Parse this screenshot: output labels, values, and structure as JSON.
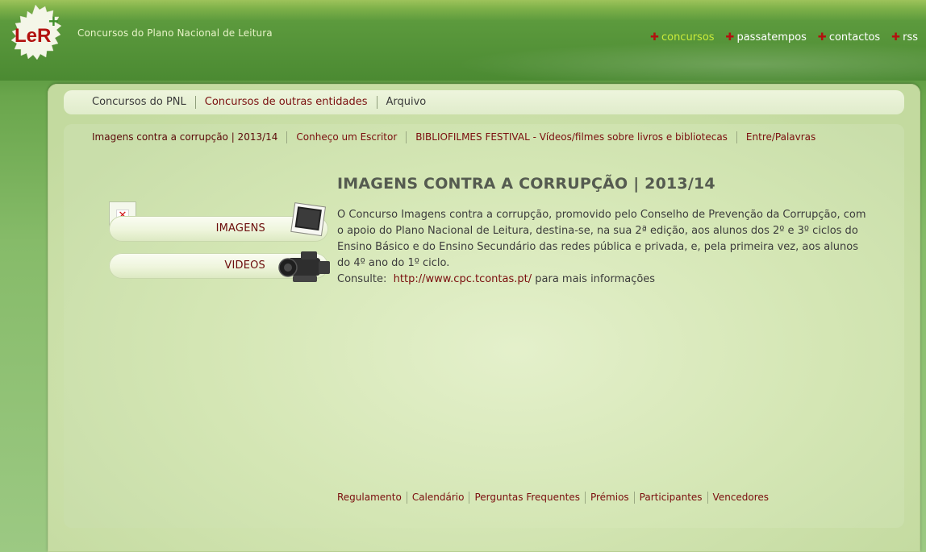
{
  "header": {
    "logo_text": "LeR",
    "logo_plus": "+",
    "tagline": "Concursos do Plano Nacional de Leitura",
    "nav": [
      {
        "label": "concursos",
        "active": true
      },
      {
        "label": "passatempos",
        "active": false
      },
      {
        "label": "contactos",
        "active": false
      },
      {
        "label": "rss",
        "active": false
      }
    ],
    "nav_marker": "✚"
  },
  "tabs": [
    {
      "label": "Concursos do PNL",
      "active": false
    },
    {
      "label": "Concursos de outras entidades",
      "active": true
    },
    {
      "label": "Arquivo",
      "active": false
    }
  ],
  "subnav": [
    {
      "label": "Imagens contra a corrupção | 2013/14",
      "active": true
    },
    {
      "label": "Conheço um Escritor",
      "active": false
    },
    {
      "label": "BIBLIOFILMES FESTIVAL - Vídeos/filmes sobre livros e bibliotecas",
      "active": false
    },
    {
      "label": "Entre/Palavras",
      "active": false
    }
  ],
  "sidebar": {
    "broken_image_icon": "broken-image-icon",
    "buttons": [
      {
        "label": "IMAGENS",
        "icon": "photo-icon"
      },
      {
        "label": "VIDEOS",
        "icon": "video-camera-icon"
      }
    ]
  },
  "content": {
    "title": "IMAGENS CONTRA A CORRUPÇÃO | 2013/14",
    "paragraph": "O Concurso Imagens contra a corrupção, promovido pelo Conselho de Prevenção da Corrupção, com o apoio do Plano Nacional de Leitura, destina-se, na sua 2ª edição, aos alunos dos 2º e 3º ciclos do Ensino Básico e do Ensino Secundário das redes pública e privada, e, pela primeira vez,  aos alunos do 4º ano do 1º ciclo.",
    "consult_prefix": "Consulte:",
    "link": "http://www.cpc.tcontas.pt/",
    "consult_suffix": "para mais informações"
  },
  "footer_links": [
    "Regulamento",
    "Calendário",
    "Perguntas Frequentes",
    "Prémios",
    "Participantes",
    "Vencedores"
  ],
  "colors": {
    "accent_active_nav": "#c9ea3a",
    "link_red": "#7a0e0e",
    "plus_red": "#b2110f"
  }
}
